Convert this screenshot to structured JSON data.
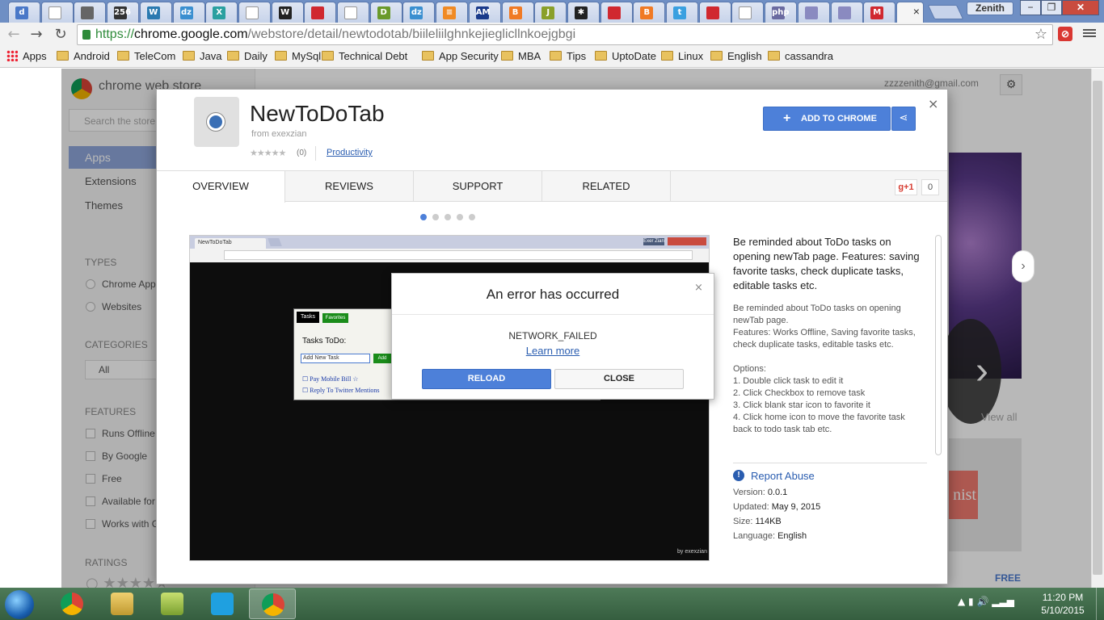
{
  "browser": {
    "profile_name": "Zenith",
    "window_controls": [
      "−",
      "❐",
      "✕"
    ],
    "tab_favicons": [
      {
        "icon": "d-icon",
        "letter": "d",
        "color": "#4a78c8"
      },
      {
        "icon": "page-icon",
        "letter": "",
        "color": "#ffffff"
      },
      {
        "icon": "robot-icon",
        "letter": "",
        "color": "#666666"
      },
      {
        "icon": "256-icon",
        "letter": "256",
        "color": "#333333"
      },
      {
        "icon": "wordpress-icon",
        "letter": "W",
        "color": "#2a7ab0"
      },
      {
        "icon": "dzone-icon",
        "letter": "dz",
        "color": "#3a8fd0"
      },
      {
        "icon": "x-icon",
        "letter": "X",
        "color": "#2aa0a0"
      },
      {
        "icon": "page-icon",
        "letter": "",
        "color": "#ffffff"
      },
      {
        "icon": "w-icon",
        "letter": "W",
        "color": "#222222"
      },
      {
        "icon": "oracle-icon",
        "letter": "",
        "color": "#d0282f"
      },
      {
        "icon": "page-icon",
        "letter": "",
        "color": "#ffffff"
      },
      {
        "icon": "d-green-icon",
        "letter": "D",
        "color": "#6a9a2a"
      },
      {
        "icon": "dzone-icon",
        "letter": "dz",
        "color": "#3a8fd0"
      },
      {
        "icon": "stack-icon",
        "letter": "≡",
        "color": "#f08a24"
      },
      {
        "icon": "am-icon",
        "letter": "AM",
        "color": "#1a3a8a"
      },
      {
        "icon": "blogger-icon",
        "letter": "B",
        "color": "#f07a24"
      },
      {
        "icon": "java-icon",
        "letter": "J",
        "color": "#8aa02a"
      },
      {
        "icon": "joomla-icon",
        "letter": "✱",
        "color": "#222222"
      },
      {
        "icon": "oracle-icon",
        "letter": "",
        "color": "#d0282f"
      },
      {
        "icon": "blogger-icon",
        "letter": "B",
        "color": "#f07a24"
      },
      {
        "icon": "twitter-icon",
        "letter": "t",
        "color": "#3aa0e0"
      },
      {
        "icon": "oracle-icon",
        "letter": "",
        "color": "#d0282f"
      },
      {
        "icon": "page-icon",
        "letter": "",
        "color": "#ffffff"
      },
      {
        "icon": "php-icon",
        "letter": "php",
        "color": "#6a6aa0"
      },
      {
        "icon": "person-icon",
        "letter": "",
        "color": "#8a8ac0"
      },
      {
        "icon": "person-icon",
        "letter": "",
        "color": "#8a8ac0"
      },
      {
        "icon": "gmail-icon",
        "letter": "M",
        "color": "#d0282f"
      }
    ],
    "url": {
      "scheme": "https://",
      "host": "chrome.google.com",
      "path": "/webstore/detail/newtodotab/biileliilghnkejieglicllnkoejgbgi"
    },
    "bookmarks": [
      {
        "label": "Apps",
        "type": "apps"
      },
      {
        "label": "Android",
        "type": "folder"
      },
      {
        "label": "TeleCom",
        "type": "folder"
      },
      {
        "label": "Java",
        "type": "folder"
      },
      {
        "label": "Daily",
        "type": "folder"
      },
      {
        "label": "MySql",
        "type": "folder"
      },
      {
        "label": "Technical Debt",
        "type": "folder"
      },
      {
        "label": "App Security",
        "type": "folder"
      },
      {
        "label": "MBA",
        "type": "folder"
      },
      {
        "label": "Tips",
        "type": "folder"
      },
      {
        "label": "UptoDate",
        "type": "folder"
      },
      {
        "label": "Linux",
        "type": "folder"
      },
      {
        "label": "English",
        "type": "folder"
      },
      {
        "label": "cassandra",
        "type": "folder"
      }
    ]
  },
  "store": {
    "title": "chrome web store",
    "search_placeholder": "Search the store",
    "nav": [
      "Apps",
      "Extensions",
      "Themes"
    ],
    "types_heading": "TYPES",
    "types": [
      "Chrome Apps",
      "Websites"
    ],
    "categories_heading": "CATEGORIES",
    "category_value": "All",
    "features_heading": "FEATURES",
    "features": [
      "Runs Offline",
      "By Google",
      "Free",
      "Available for Android",
      "Works with Google Drive"
    ],
    "ratings_heading": "RATINGS",
    "email": "zzzzenith@gmail.com",
    "view_all": "View all",
    "free_label": "FREE",
    "gist_text": "nist"
  },
  "extension": {
    "name": "NewToDoTab",
    "from": "from exexzian",
    "rating_stars": "★★★★★",
    "rating_count": "(0)",
    "category": "Productivity",
    "add_button": "ADD TO CHROME",
    "tabs": [
      "OVERVIEW",
      "REVIEWS",
      "SUPPORT",
      "RELATED"
    ],
    "gplus": "g+1",
    "gplus_count": "0",
    "slide_count": 5,
    "active_slide": 1,
    "description_bold": "Be reminded about ToDo tasks on opening newTab page. Features: saving favorite tasks, check duplicate tasks, editable tasks etc.",
    "description_body": "Be reminded about ToDo tasks on opening newTab page.\nFeatures: Works Offline, Saving favorite tasks, check duplicate tasks, editable tasks etc.\n\nOptions:\n1. Double click task to edit it\n2. Click Checkbox to remove task\n3. Click blank star icon to favorite it\n4. Click home icon to move the favorite task back to todo task tab etc.",
    "report_abuse": "Report Abuse",
    "meta": {
      "version_label": "Version:",
      "version": "0.0.1",
      "updated_label": "Updated:",
      "updated": "May 9, 2015",
      "size_label": "Size:",
      "size": "114KB",
      "language_label": "Language:",
      "language": "English"
    }
  },
  "screenshot": {
    "tab_title": "NewToDoTab",
    "profile": "Exer Zian",
    "tasks_tab": "Tasks",
    "favorites_tab": "Favorites",
    "heading": "Tasks ToDo:",
    "input_value": "Add New Task",
    "add_label": "Add",
    "items": [
      "Pay Mobile Bill",
      "Reply To Twitter Mentions"
    ],
    "byline": "by exexzian"
  },
  "error": {
    "title": "An error has occurred",
    "code": "NETWORK_FAILED",
    "learn_more": "Learn more",
    "reload": "RELOAD",
    "close": "CLOSE"
  },
  "taskbar": {
    "time": "11:20 PM",
    "date": "5/10/2015",
    "apps": [
      "chrome-icon",
      "file-explorer-icon",
      "sticky-notes-icon",
      "skype-icon",
      "chrome-icon"
    ]
  }
}
